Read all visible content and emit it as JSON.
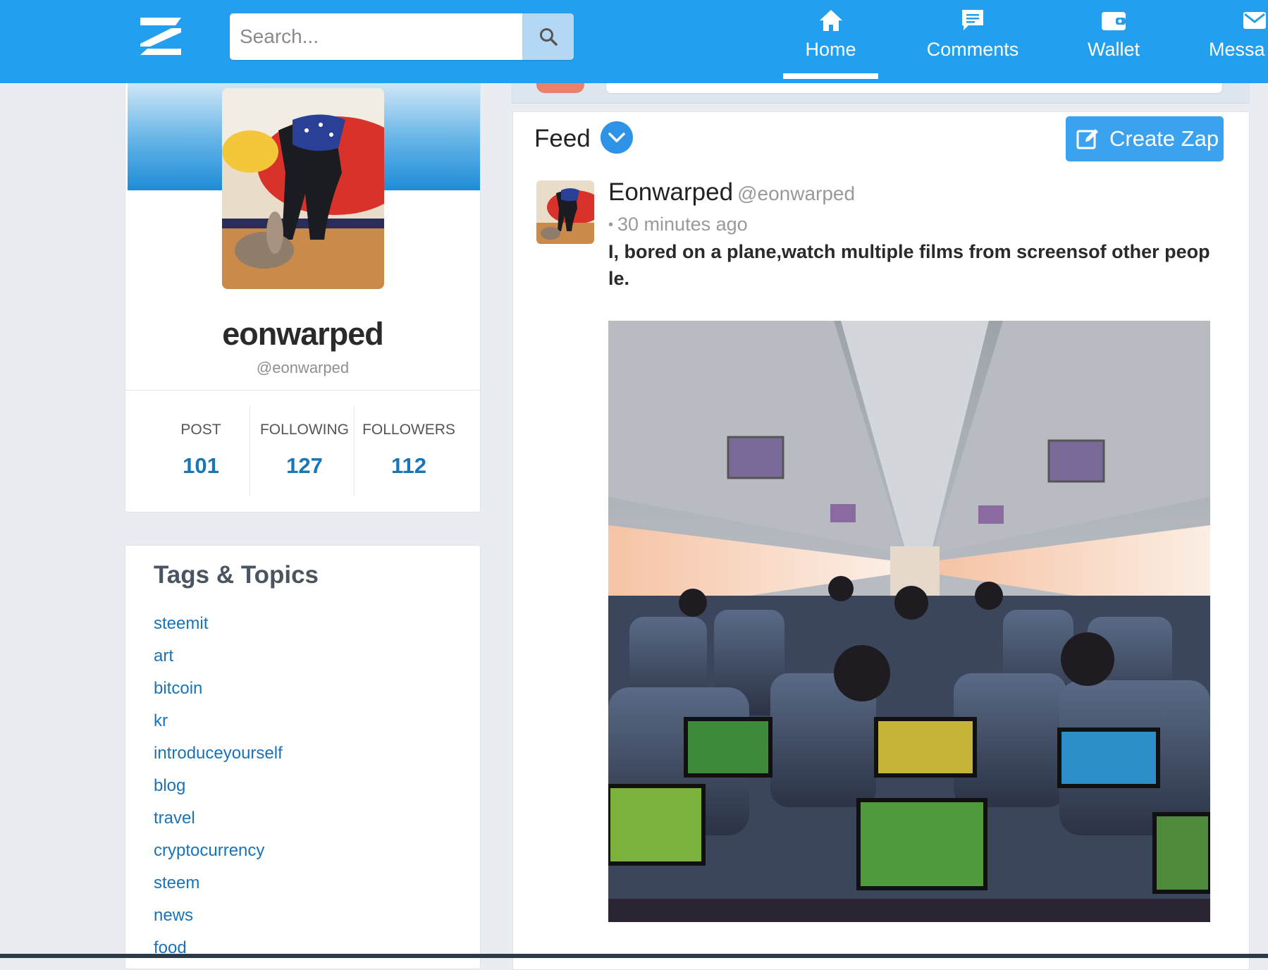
{
  "header": {
    "search_placeholder": "Search...",
    "nav": [
      {
        "label": "Home",
        "icon": "home-icon",
        "active": true
      },
      {
        "label": "Comments",
        "icon": "comments-icon"
      },
      {
        "label": "Wallet",
        "icon": "wallet-icon"
      },
      {
        "label": "Messa",
        "icon": "messages-icon"
      }
    ],
    "brand_color": "#22a0ef"
  },
  "profile": {
    "name": "eonwarped",
    "handle": "@eonwarped",
    "stats": [
      {
        "label": "POST",
        "value": "101"
      },
      {
        "label": "FOLLOWING",
        "value": "127"
      },
      {
        "label": "FOLLOWERS",
        "value": "112"
      }
    ]
  },
  "tags": {
    "title": "Tags & Topics",
    "items": [
      "steemit",
      "art",
      "bitcoin",
      "kr",
      "introduceyourself",
      "blog",
      "travel",
      "cryptocurrency",
      "steem",
      "news",
      "food"
    ]
  },
  "feed": {
    "title": "Feed",
    "create_label": "Create Zap",
    "post": {
      "author": "Eonwarped",
      "handle": "@eonwarped",
      "time": "30 minutes ago",
      "text": "I, bored on a plane,watch multiple films from screensof other people."
    }
  }
}
